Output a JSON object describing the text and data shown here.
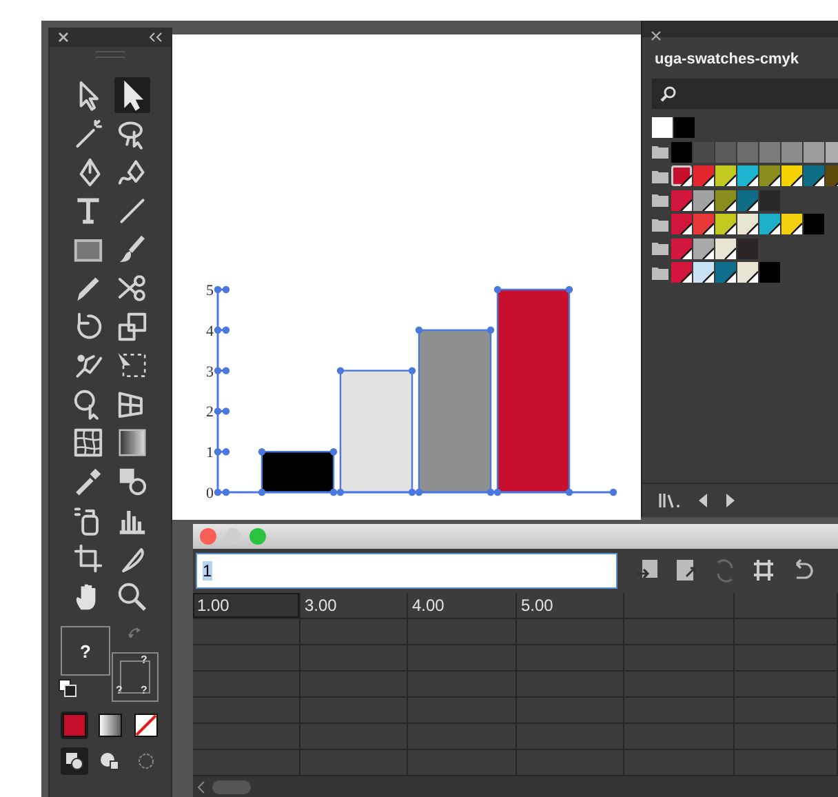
{
  "tools": [
    {
      "kind": "selection",
      "selected": false
    },
    {
      "kind": "direct-selection",
      "selected": true
    },
    {
      "kind": "magic-wand",
      "selected": false
    },
    {
      "kind": "lasso",
      "selected": false
    },
    {
      "kind": "pen",
      "selected": false
    },
    {
      "kind": "curvature",
      "selected": false
    },
    {
      "kind": "type",
      "selected": false
    },
    {
      "kind": "line",
      "selected": false
    },
    {
      "kind": "rectangle",
      "selected": false
    },
    {
      "kind": "brush",
      "selected": false
    },
    {
      "kind": "pencil",
      "selected": false
    },
    {
      "kind": "scissors",
      "selected": false
    },
    {
      "kind": "rotate",
      "selected": false
    },
    {
      "kind": "scale",
      "selected": false
    },
    {
      "kind": "puppet-warp",
      "selected": false
    },
    {
      "kind": "free-transform",
      "selected": false
    },
    {
      "kind": "shape-builder",
      "selected": false
    },
    {
      "kind": "perspective",
      "selected": false
    },
    {
      "kind": "mesh",
      "selected": false
    },
    {
      "kind": "gradient",
      "selected": false
    },
    {
      "kind": "eyedropper",
      "selected": false
    },
    {
      "kind": "blend",
      "selected": false
    },
    {
      "kind": "symbol-sprayer",
      "selected": false
    },
    {
      "kind": "column-graph",
      "selected": false
    },
    {
      "kind": "artboard",
      "selected": false
    },
    {
      "kind": "slice",
      "selected": false
    },
    {
      "kind": "hand",
      "selected": false
    },
    {
      "kind": "zoom",
      "selected": false
    }
  ],
  "fill_stroke": {
    "fill_label": "?",
    "stroke_labels": [
      "?",
      "?",
      "?"
    ]
  },
  "color_modes": [
    {
      "kind": "color",
      "selected": true
    },
    {
      "kind": "gradient",
      "selected": false
    },
    {
      "kind": "none",
      "selected": false
    }
  ],
  "draw_modes": [
    {
      "kind": "normal",
      "selected": true
    },
    {
      "kind": "behind",
      "selected": false
    },
    {
      "kind": "inside",
      "selected": false
    }
  ],
  "chart_data": {
    "type": "bar",
    "ylim": [
      0,
      5
    ],
    "yticks": [
      0,
      1,
      2,
      3,
      4,
      5
    ],
    "series": [
      {
        "color": "#000000",
        "values": [
          1
        ]
      },
      {
        "color": "#e2e2e2",
        "values": [
          3
        ]
      },
      {
        "color": "#8e8f91",
        "values": [
          4
        ]
      },
      {
        "color": "#c8102e",
        "values": [
          5
        ]
      }
    ]
  },
  "swatches_panel": {
    "title": "uga-swatches-cmyk",
    "rows": [
      {
        "folder": false,
        "swatches": [
          {
            "color": "#ffffff",
            "global": false,
            "selected": false
          },
          {
            "color": "#000000",
            "global": false,
            "selected": false
          }
        ]
      },
      {
        "folder": true,
        "swatches": [
          {
            "color": "#000000",
            "global": false,
            "selected": false
          },
          {
            "color": "#4a4a4a",
            "global": false,
            "selected": false
          },
          {
            "color": "#5a5a5a",
            "global": false,
            "selected": false
          },
          {
            "color": "#6c6c6c",
            "global": false,
            "selected": false
          },
          {
            "color": "#7c7c7c",
            "global": false,
            "selected": false
          },
          {
            "color": "#8c8c8c",
            "global": false,
            "selected": false
          },
          {
            "color": "#9c9c9c",
            "global": false,
            "selected": false
          },
          {
            "color": "#acacac",
            "global": false,
            "selected": false
          }
        ]
      },
      {
        "folder": true,
        "swatches": [
          {
            "color": "#c8102e",
            "global": true,
            "selected": true
          },
          {
            "color": "#e4262f",
            "global": true,
            "selected": false
          },
          {
            "color": "#c2c81e",
            "global": true,
            "selected": false
          },
          {
            "color": "#1cb4cf",
            "global": true,
            "selected": false
          },
          {
            "color": "#8a8e1c",
            "global": true,
            "selected": false
          },
          {
            "color": "#f4d100",
            "global": true,
            "selected": false
          },
          {
            "color": "#0f6e86",
            "global": true,
            "selected": false
          },
          {
            "color": "#5e4a0c",
            "global": true,
            "selected": false
          }
        ]
      },
      {
        "folder": true,
        "swatches": [
          {
            "color": "#d3163c",
            "global": true,
            "selected": false
          },
          {
            "color": "#a2a2a2",
            "global": true,
            "selected": false
          },
          {
            "color": "#8a8e1c",
            "global": true,
            "selected": false
          },
          {
            "color": "#0f6e86",
            "global": true,
            "selected": false
          },
          {
            "color": "#2a2828",
            "global": false,
            "selected": false
          }
        ]
      },
      {
        "folder": true,
        "swatches": [
          {
            "color": "#d3163c",
            "global": true,
            "selected": false
          },
          {
            "color": "#e63838",
            "global": true,
            "selected": false
          },
          {
            "color": "#c2c81e",
            "global": true,
            "selected": false
          },
          {
            "color": "#e9e5d3",
            "global": true,
            "selected": false
          },
          {
            "color": "#1cb0c9",
            "global": true,
            "selected": false
          },
          {
            "color": "#f2d00f",
            "global": true,
            "selected": false
          },
          {
            "color": "#000000",
            "global": false,
            "selected": false
          }
        ]
      },
      {
        "folder": true,
        "swatches": [
          {
            "color": "#d3163c",
            "global": true,
            "selected": false
          },
          {
            "color": "#a8a8a8",
            "global": true,
            "selected": false
          },
          {
            "color": "#e9e5d3",
            "global": true,
            "selected": false
          },
          {
            "color": "#2a2626",
            "global": false,
            "selected": false
          }
        ]
      },
      {
        "folder": true,
        "swatches": [
          {
            "color": "#d3163c",
            "global": true,
            "selected": false
          },
          {
            "color": "#c8e4f4",
            "global": true,
            "selected": false
          },
          {
            "color": "#0f6e8e",
            "global": true,
            "selected": false
          },
          {
            "color": "#e9e5d3",
            "global": true,
            "selected": false
          },
          {
            "color": "#000000",
            "global": false,
            "selected": false
          }
        ]
      }
    ]
  },
  "data_window": {
    "input": {
      "value": "1"
    },
    "buttons": [
      {
        "kind": "import",
        "disabled": false
      },
      {
        "kind": "transpose",
        "disabled": false
      },
      {
        "kind": "switch-xy",
        "disabled": true
      },
      {
        "kind": "cell-style",
        "disabled": false
      },
      {
        "kind": "revert",
        "disabled": false
      }
    ],
    "rows": [
      [
        {
          "text": "1.00",
          "selected": true
        },
        {
          "text": "3.00",
          "selected": false
        },
        {
          "text": "4.00",
          "selected": false
        },
        {
          "text": "5.00",
          "selected": false
        }
      ]
    ]
  }
}
